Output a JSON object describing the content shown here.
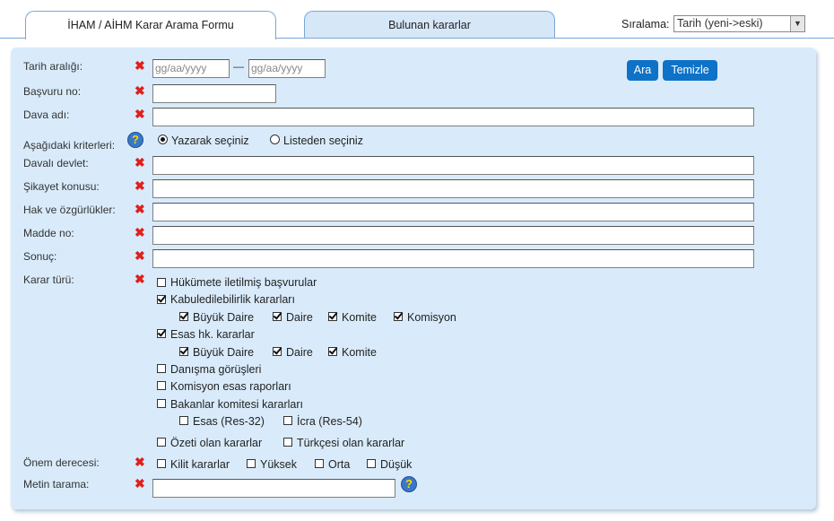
{
  "tabs": {
    "search_form": "İHAM / AİHM Karar Arama Formu",
    "results": "Bulunan kararlar"
  },
  "sort": {
    "label": "Sıralama:",
    "value": "Tarih (yeni->eski)"
  },
  "buttons": {
    "search": "Ara",
    "clear": "Temizle"
  },
  "labels": {
    "date_range": "Tarih aralığı:",
    "application_no": "Başvuru no:",
    "case_name": "Dava adı:",
    "criteria": "Aşağıdaki kriterleri:",
    "respondent_state": "Davalı devlet:",
    "complaint_subject": "Şikayet konusu:",
    "rights": "Hak ve özgürlükler:",
    "article_no": "Madde no:",
    "result": "Sonuç:",
    "decision_type": "Karar türü:",
    "importance": "Önem derecesi:",
    "text_search": "Metin tarama:"
  },
  "date": {
    "from_placeholder": "gg/aa/yyyy",
    "to_placeholder": "gg/aa/yyyy",
    "separator": "—"
  },
  "criteria_options": {
    "typing": "Yazarak seçiniz",
    "list": "Listeden seçiniz"
  },
  "decision_types": {
    "communicated": "Hükümete iletilmiş başvurular",
    "admissibility": "Kabuledilebilirlik kararları",
    "merits": "Esas hk. kararlar",
    "grand_chamber": "Büyük Daire",
    "chamber": "Daire",
    "committee": "Komite",
    "commission": "Komisyon",
    "advisory": "Danışma görüşleri",
    "commission_reports": "Komisyon esas raporları",
    "cm_decisions": "Bakanlar komitesi kararları",
    "res32": "Esas (Res-32)",
    "res54": "İcra (Res-54)",
    "with_summary": "Özeti olan kararlar",
    "with_turkish": "Türkçesi olan kararlar"
  },
  "importance_levels": {
    "key": "Kilit kararlar",
    "high": "Yüksek",
    "medium": "Orta",
    "low": "Düşük"
  },
  "help_symbol": "?",
  "clear_symbol": "✖"
}
